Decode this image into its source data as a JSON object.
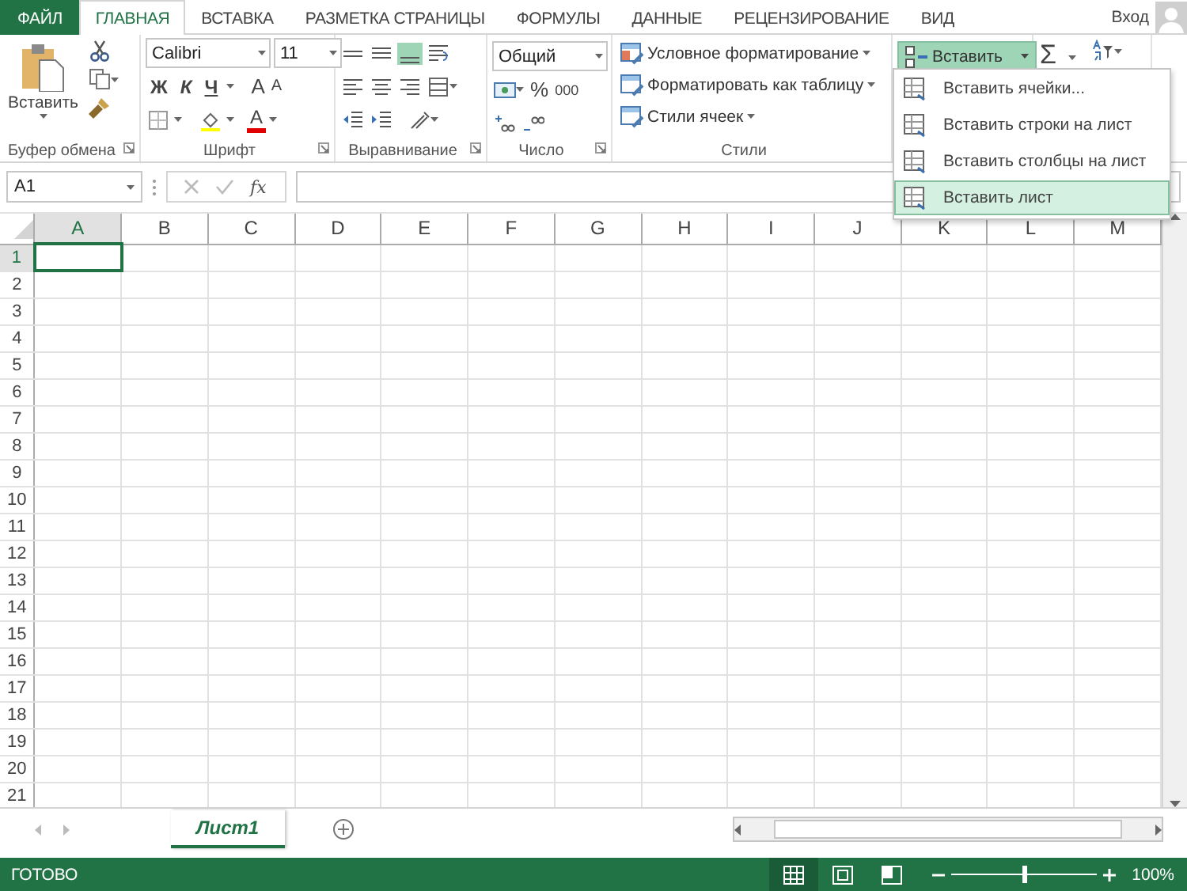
{
  "tabs": [
    {
      "label": "ФАЙЛ",
      "kind": "file",
      "selected": false
    },
    {
      "label": "ГЛАВНАЯ",
      "kind": "tab",
      "selected": true
    },
    {
      "label": "ВСТАВКА",
      "kind": "tab",
      "selected": false
    },
    {
      "label": "РАЗМЕТКА СТРАНИЦЫ",
      "kind": "tab",
      "selected": false
    },
    {
      "label": "ФОРМУЛЫ",
      "kind": "tab",
      "selected": false
    },
    {
      "label": "ДАННЫЕ",
      "kind": "tab",
      "selected": false
    },
    {
      "label": "РЕЦЕНЗИРОВАНИЕ",
      "kind": "tab",
      "selected": false
    },
    {
      "label": "ВИД",
      "kind": "tab",
      "selected": false
    }
  ],
  "account": {
    "label": "Вход"
  },
  "ribbon": {
    "clipboard": {
      "paste": "Вставить",
      "label": "Буфер обмена"
    },
    "font": {
      "name": "Calibri",
      "size": "11",
      "bold": "Ж",
      "italic": "К",
      "underline": "Ч",
      "grow": "A",
      "shrink": "A",
      "color_letter": "А",
      "label": "Шрифт"
    },
    "alignment": {
      "label": "Выравнивание"
    },
    "number": {
      "format": "Общий",
      "percent": "%",
      "thousands": "000",
      "label": "Число"
    },
    "styles": {
      "items": [
        "Условное форматирование",
        "Форматировать как таблицу",
        "Стили ячеек"
      ],
      "label": "Стили"
    },
    "cells": {
      "insert": {
        "label": "Вставить",
        "expanded": true
      }
    },
    "editing": {
      "sum": "Σ"
    }
  },
  "insert_menu": [
    {
      "label": "Вставить ячейки...",
      "selected": false
    },
    {
      "label": "Вставить строки на лист",
      "selected": false
    },
    {
      "label": "Вставить столбцы на лист",
      "selected": false
    },
    {
      "label": "Вставить лист",
      "selected": true
    }
  ],
  "formula_bar": {
    "name_box": "A1",
    "function": "fx"
  },
  "sheet": {
    "columns": [
      {
        "label": "A",
        "selected": true
      },
      {
        "label": "B",
        "selected": false
      },
      {
        "label": "C",
        "selected": false
      },
      {
        "label": "D",
        "selected": false
      },
      {
        "label": "E",
        "selected": false
      },
      {
        "label": "F",
        "selected": false
      },
      {
        "label": "G",
        "selected": false
      },
      {
        "label": "H",
        "selected": false
      },
      {
        "label": "I",
        "selected": false
      },
      {
        "label": "J",
        "selected": false
      },
      {
        "label": "K",
        "selected": false
      },
      {
        "label": "L",
        "selected": false
      },
      {
        "label": "M",
        "selected": false
      }
    ],
    "rows": [
      {
        "label": "1",
        "selected": true
      },
      {
        "label": "2",
        "selected": false
      },
      {
        "label": "3",
        "selected": false
      },
      {
        "label": "4",
        "selected": false
      },
      {
        "label": "5",
        "selected": false
      },
      {
        "label": "6",
        "selected": false
      },
      {
        "label": "7",
        "selected": false
      },
      {
        "label": "8",
        "selected": false
      },
      {
        "label": "9",
        "selected": false
      },
      {
        "label": "10",
        "selected": false
      },
      {
        "label": "11",
        "selected": false
      },
      {
        "label": "12",
        "selected": false
      },
      {
        "label": "13",
        "selected": false
      },
      {
        "label": "14",
        "selected": false
      },
      {
        "label": "15",
        "selected": false
      },
      {
        "label": "16",
        "selected": false
      },
      {
        "label": "17",
        "selected": false
      },
      {
        "label": "18",
        "selected": false
      },
      {
        "label": "19",
        "selected": false
      },
      {
        "label": "20",
        "selected": false
      },
      {
        "label": "21",
        "selected": false
      }
    ]
  },
  "sheet_tabs": [
    {
      "label": "Лист1",
      "selected": true
    }
  ],
  "status_bar": {
    "status": "ГОТОВО",
    "zoom": {
      "level": 0.5,
      "reading": "100%"
    }
  }
}
